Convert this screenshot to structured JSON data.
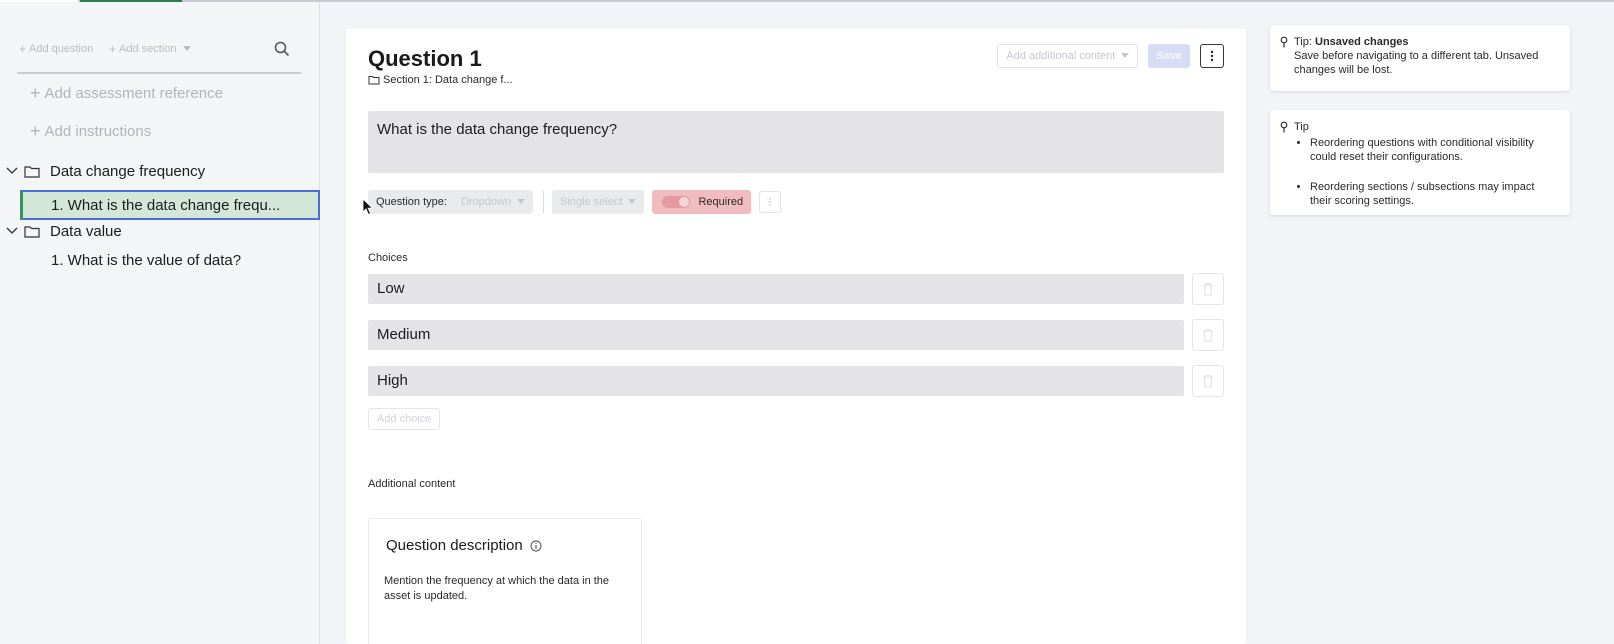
{
  "sidebar": {
    "toolbar": {
      "add_question": "Add question",
      "add_section": "Add section"
    },
    "add_assessment_reference": "Add assessment reference",
    "add_instructions": "Add instructions",
    "sections": [
      {
        "title": "Data change frequency",
        "questions": [
          "1. What is the data change frequ..."
        ]
      },
      {
        "title": "Data value",
        "questions": [
          "1. What is the value of data?"
        ]
      }
    ]
  },
  "question": {
    "title": "Question 1",
    "section_ref": "Section 1: Data change f...",
    "add_additional_content": "Add additional content",
    "save": "Save",
    "text": "What is the data change frequency?",
    "question_type_label": "Question type:",
    "question_type_value": "Dropdown",
    "select_mode": "Single select",
    "required_label": "Required",
    "required_on": true,
    "choices_label": "Choices",
    "choices": [
      "Low",
      "Medium",
      "High"
    ],
    "add_choice": "Add choice",
    "additional_content_label": "Additional content",
    "description": {
      "title": "Question description",
      "body": "Mention the frequency at which the data in the asset is updated."
    }
  },
  "tips": {
    "unsaved": {
      "prefix": "Tip: ",
      "title": "Unsaved changes",
      "body": "Save before navigating to a different tab. Unsaved changes will be lost."
    },
    "general": {
      "title": "Tip",
      "items": [
        "Reordering questions with conditional visibility could reset their configurations.",
        "Reordering sections / subsections may impact their scoring settings."
      ]
    }
  },
  "colors": {
    "selected_row_bg": "#d3e7d9",
    "selected_row_border": "#4a6fd8",
    "required_bg": "#f0bcbf",
    "save_bg": "#d7dcf5"
  },
  "icons": [
    "search-icon",
    "chevron-down-icon",
    "folder-icon",
    "more-vertical-icon",
    "trash-icon",
    "info-icon",
    "pin-icon",
    "cursor-icon"
  ]
}
